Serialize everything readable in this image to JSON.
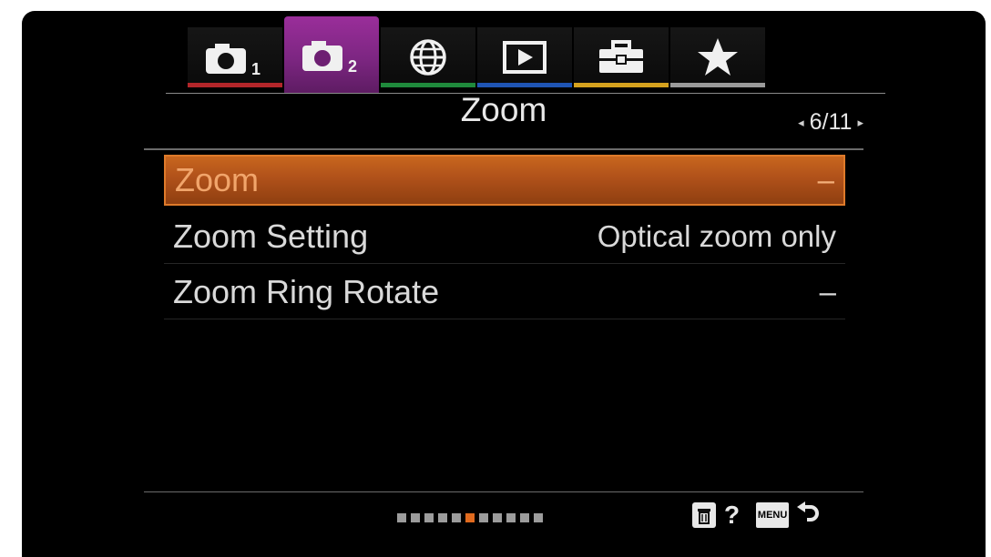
{
  "tabs": [
    {
      "name": "shooting-1",
      "icon": "camera-icon",
      "subscript": "1",
      "stripe": "#b3262a",
      "active": false
    },
    {
      "name": "shooting-2",
      "icon": "camera-icon",
      "subscript": "2",
      "stripe": "#8a2c8e",
      "active": true
    },
    {
      "name": "network",
      "icon": "globe-icon",
      "subscript": "",
      "stripe": "#1f8a3c",
      "active": false
    },
    {
      "name": "playback",
      "icon": "play-icon",
      "subscript": "",
      "stripe": "#1f55b5",
      "active": false
    },
    {
      "name": "setup",
      "icon": "toolbox-icon",
      "subscript": "",
      "stripe": "#d6a21e",
      "active": false
    },
    {
      "name": "my-menu",
      "icon": "star-icon",
      "subscript": "",
      "stripe": "#9a9a9a",
      "active": false
    }
  ],
  "header": {
    "title": "Zoom",
    "page": "6/11"
  },
  "menu": {
    "items": [
      {
        "label": "Zoom",
        "value": "–",
        "selected": true
      },
      {
        "label": "Zoom Setting",
        "value": "Optical zoom only",
        "selected": false
      },
      {
        "label": "Zoom Ring Rotate",
        "value": "–",
        "selected": false
      }
    ]
  },
  "footer": {
    "page_count": 11,
    "current_page": 6,
    "help_symbol": "?",
    "menu_label": "MENU"
  },
  "colors": {
    "accent": "#c8661e",
    "active_tab": "#8a2c8e",
    "background": "#000000"
  }
}
